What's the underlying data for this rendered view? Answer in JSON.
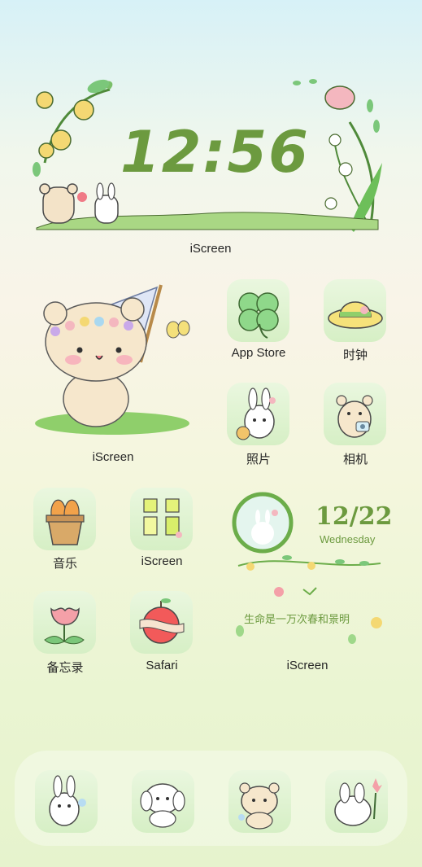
{
  "clock_widget": {
    "time": "12:56",
    "label": "iScreen"
  },
  "photo_widget": {
    "label": "iScreen"
  },
  "date_widget": {
    "date": "12/22",
    "weekday": "Wednesday",
    "quote": "生命是一万次春和景明",
    "label": "iScreen"
  },
  "apps": [
    {
      "name": "app-store",
      "label": "App Store"
    },
    {
      "name": "clock",
      "label": "时钟"
    },
    {
      "name": "photos",
      "label": "照片"
    },
    {
      "name": "camera",
      "label": "相机"
    },
    {
      "name": "music",
      "label": "音乐"
    },
    {
      "name": "iscreen",
      "label": "iScreen"
    },
    {
      "name": "notes",
      "label": "备忘录"
    },
    {
      "name": "safari",
      "label": "Safari"
    }
  ],
  "dock_icons": [
    "bunny-icon",
    "puppy-icon",
    "bear-icon",
    "bunny-back-icon"
  ],
  "colors": {
    "accent_green": "#6c9a3f",
    "tile_green": "#d6efc5"
  }
}
